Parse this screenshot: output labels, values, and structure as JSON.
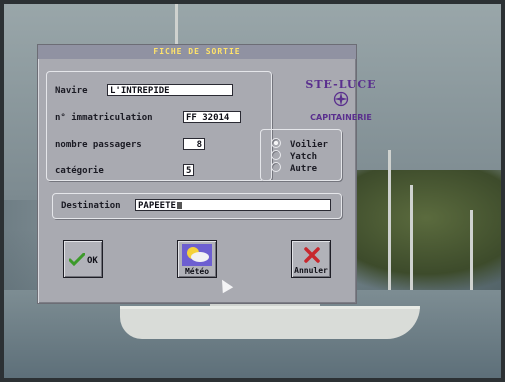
{
  "dialog": {
    "title": "FICHE DE SORTIE",
    "fields": {
      "navire": {
        "label": "Navire",
        "value": "L'INTREPIDE"
      },
      "immatriculation": {
        "label": "n° immatriculation",
        "value": "FF 32014"
      },
      "passagers": {
        "label": "nombre passagers",
        "value": "8"
      },
      "categorie": {
        "label": "catégorie",
        "value": "5"
      },
      "destination": {
        "label": "Destination",
        "value": "PAPEETE"
      }
    },
    "logo": {
      "top": "STE-LUCE",
      "bottom": "CAPITAINERIE"
    },
    "boat_type": {
      "options": [
        "Voilier",
        "Yatch",
        "Autre"
      ],
      "selected": "Voilier"
    },
    "buttons": {
      "ok": "OK",
      "meteo": "Météo",
      "annuler": "Annuler"
    }
  },
  "colors": {
    "dialog_bg": "#a9aab1",
    "title_text": "#ffe36a",
    "logo": "#5a2f8e",
    "ok_check": "#3c9a2a",
    "cancel_x": "#c8282e"
  },
  "icons": [
    "checkmark-icon",
    "weather-icon",
    "cancel-x-icon",
    "mouse-cursor-icon"
  ]
}
